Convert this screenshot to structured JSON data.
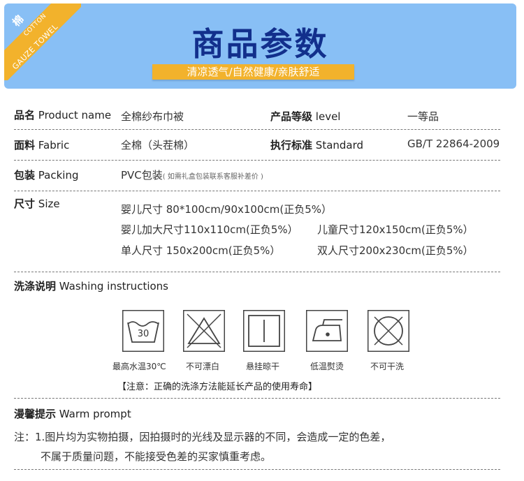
{
  "banner": {
    "corner_zh": "棉",
    "corner_cotton": "COTTON",
    "corner_gauze": "GAUZE TOWEL",
    "title": "商品参数",
    "slogan": "清凉透气/自然健康/亲肤舒适",
    "colors": {
      "background": "#88bff5",
      "title": "#122f8c",
      "accent": "#f2b22c"
    }
  },
  "params": {
    "product_name": {
      "zh": "品名",
      "en": "Product name",
      "value": "全棉纱布巾被"
    },
    "level": {
      "zh": "产品等级",
      "en": "level",
      "value": "一等品"
    },
    "fabric": {
      "zh": "面料",
      "en": "Fabric",
      "value": "全棉（头茬棉）"
    },
    "standard": {
      "zh": "执行标准",
      "en": "Standard",
      "value": "GB/T 22864-2009"
    },
    "packing": {
      "zh": "包装",
      "en": "Packing",
      "value": "PVC包装",
      "note": "( 如需礼盒包装联系客服补差价 )"
    },
    "size": {
      "zh": "尺寸",
      "en": "Size",
      "lines": [
        "婴儿尺寸 80*100cm/90x100cm(正负5%）",
        "婴儿加大尺寸110x110cm(正负5%）",
        "儿童尺寸120x150cm(正负5%）",
        "单人尺寸 150x200cm(正负5%）",
        "双人尺寸200x230cm(正负5%）"
      ]
    }
  },
  "washing": {
    "zh": "洗涤说明",
    "en": "Washing instructions",
    "icons": [
      {
        "icon": "wash-30-icon",
        "label": "最高水温30℃",
        "temp": "30"
      },
      {
        "icon": "no-bleach-icon",
        "label": "不可漂白"
      },
      {
        "icon": "hang-dry-icon",
        "label": "悬挂晾干"
      },
      {
        "icon": "low-iron-icon",
        "label": "低温熨烫"
      },
      {
        "icon": "no-dry-clean-icon",
        "label": "不可干洗"
      }
    ],
    "notice": "【注意：正确的洗涤方法能延长产品的使用寿命】"
  },
  "prompt": {
    "zh": "漫馨提示",
    "en": "Warm prompt",
    "line1": "注：1.图片均为实物拍摄，因拍摄时的光线及显示器的不同，会造成一定的色差，",
    "line2": "不属于质量问题，不能接受色差的买家慎重考虑。"
  }
}
